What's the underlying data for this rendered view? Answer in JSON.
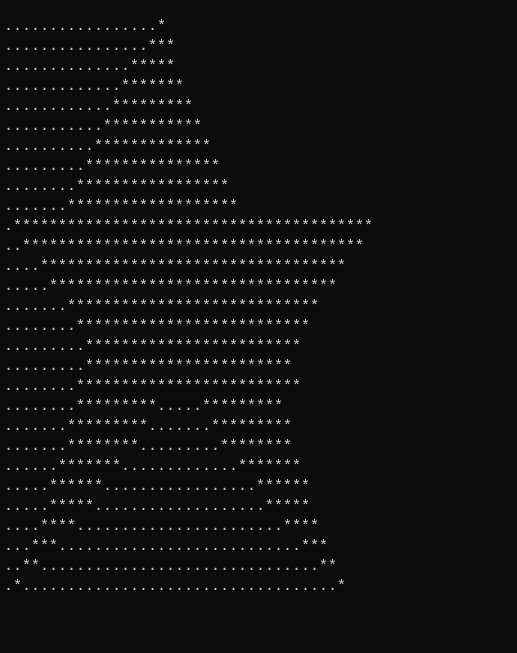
{
  "ascii": {
    "lines": [
      ".................*",
      "................***",
      "..............*****",
      ".............*******",
      "............*********",
      "...........***********",
      "..........*************",
      ".........***************",
      "........*****************",
      ".......*******************",
      ".****************************************",
      "..**************************************",
      "....**********************************",
      ".....********************************",
      ".......****************************",
      "........**************************",
      ".........************************",
      ".........***********************",
      "........*************************",
      "........*********.....*********",
      ".......*********.......*********",
      ".......********.........********",
      "......*******.............*******",
      ".....******.................******",
      ".....*****...................*****",
      "....****.......................****",
      "...***...........................***",
      "..**...............................**",
      ".*...................................*"
    ]
  }
}
